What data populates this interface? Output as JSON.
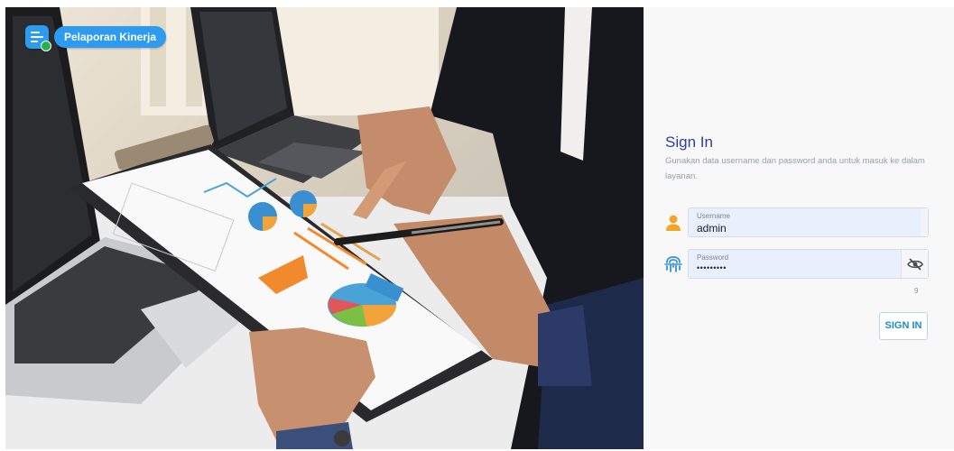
{
  "brand": {
    "name": "Pelaporan Kinerja",
    "icon": "report-checklist-icon",
    "color": "#2c9bf0"
  },
  "hero": {
    "image": "business-analytics-photo"
  },
  "signin": {
    "title": "Sign In",
    "subtitle": "Gunakan data username dan password anda untuk masuk ke dalam layanan.",
    "username": {
      "label": "Username",
      "value": "admin",
      "icon": "user-icon"
    },
    "password": {
      "label": "Password",
      "value": "•••••••••",
      "icon": "fingerprint-icon",
      "toggle_icon": "eye-off-icon",
      "counter": "9"
    },
    "button_label": "SIGN IN",
    "title_color": "#2f3f9a",
    "button_color": "#1f8bc3"
  }
}
